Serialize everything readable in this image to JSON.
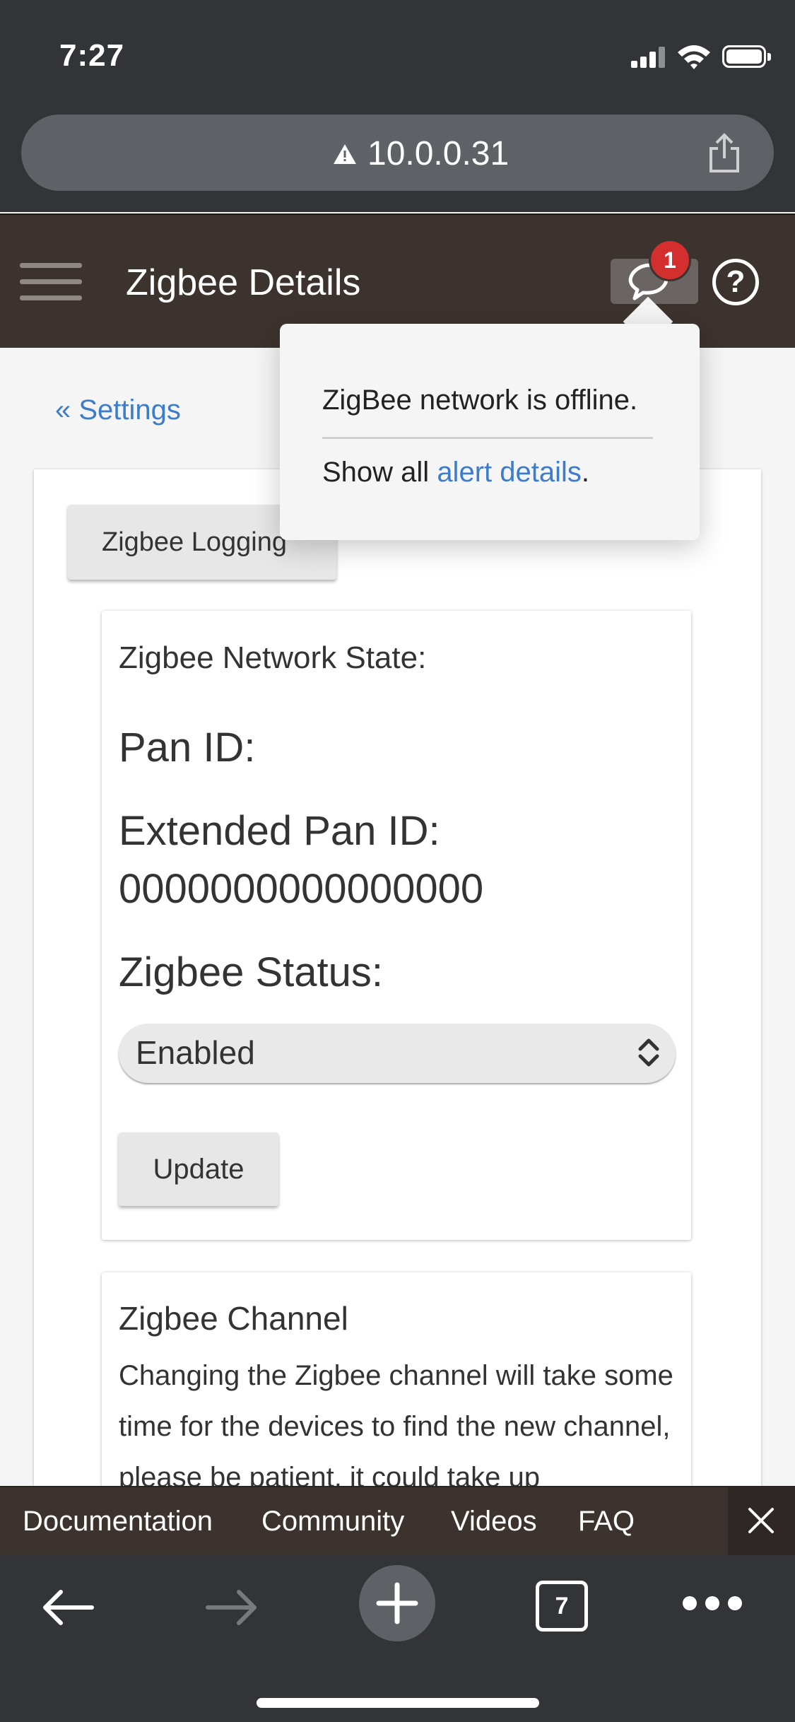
{
  "status_bar": {
    "time": "7:27"
  },
  "browser": {
    "url": "10.0.0.31",
    "tab_count": "7"
  },
  "header": {
    "title": "Zigbee Details",
    "alert_count": "1"
  },
  "breadcrumb": "« Settings",
  "buttons": {
    "logging": "Zigbee Logging",
    "update": "Update"
  },
  "network": {
    "state_label": "Zigbee Network State:",
    "pan_id_label": "Pan ID:",
    "extended_pan_id_label": "Extended Pan ID:",
    "extended_pan_id_value": "0000000000000000",
    "status_label": "Zigbee Status:",
    "status_selected": "Enabled"
  },
  "channel": {
    "title": "Zigbee Channel",
    "description": "Changing the Zigbee channel will take some time for the devices to find the new channel, please be patient, it could take up"
  },
  "alert_popover": {
    "message": "ZigBee network is offline.",
    "footer_prefix": "Show all ",
    "footer_link": "alert details",
    "footer_suffix": "."
  },
  "footer_links": {
    "documentation": "Documentation",
    "community": "Community",
    "videos": "Videos",
    "faq": "FAQ"
  },
  "colors": {
    "header_bg": "#3d332e",
    "link": "#3d7cc9",
    "badge": "#d32f2f",
    "browser_chrome": "#323437"
  }
}
